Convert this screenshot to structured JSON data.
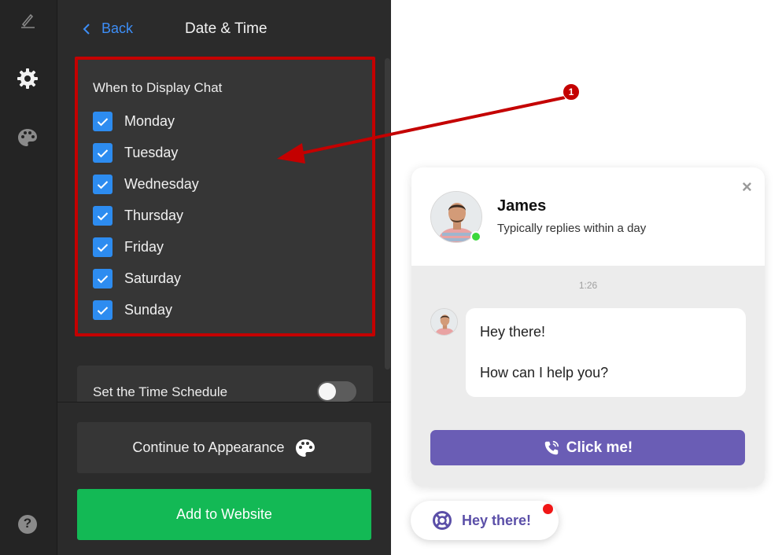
{
  "rail": {
    "icons": [
      "pencil-icon",
      "gear-icon",
      "palette-icon",
      "help-icon"
    ],
    "help_label": "?"
  },
  "header": {
    "back_label": "Back",
    "title": "Date & Time"
  },
  "days_card": {
    "heading": "When to Display Chat",
    "days": [
      {
        "label": "Monday",
        "checked": true
      },
      {
        "label": "Tuesday",
        "checked": true
      },
      {
        "label": "Wednesday",
        "checked": true
      },
      {
        "label": "Thursday",
        "checked": true
      },
      {
        "label": "Friday",
        "checked": true
      },
      {
        "label": "Saturday",
        "checked": true
      },
      {
        "label": "Sunday",
        "checked": true
      }
    ]
  },
  "schedule": {
    "label": "Set the Time Schedule",
    "enabled": false
  },
  "buttons": {
    "appearance_label": "Continue to Appearance",
    "add_label": "Add to Website"
  },
  "annotation": {
    "badge": "1",
    "color": "#c40000"
  },
  "chat": {
    "agent_name": "James",
    "agent_status": "Typically replies within a day",
    "online": true,
    "close": "×",
    "time": "1:26",
    "message_line1": "Hey there!",
    "message_line2": "How can I help you?",
    "cta_label": "Click me!",
    "accent": "#6a5db5"
  },
  "launcher": {
    "label": "Hey there!",
    "has_notification": true
  },
  "colors": {
    "check_blue": "#2d8cf0",
    "add_green": "#13b955",
    "link_blue": "#3d8ef7"
  }
}
